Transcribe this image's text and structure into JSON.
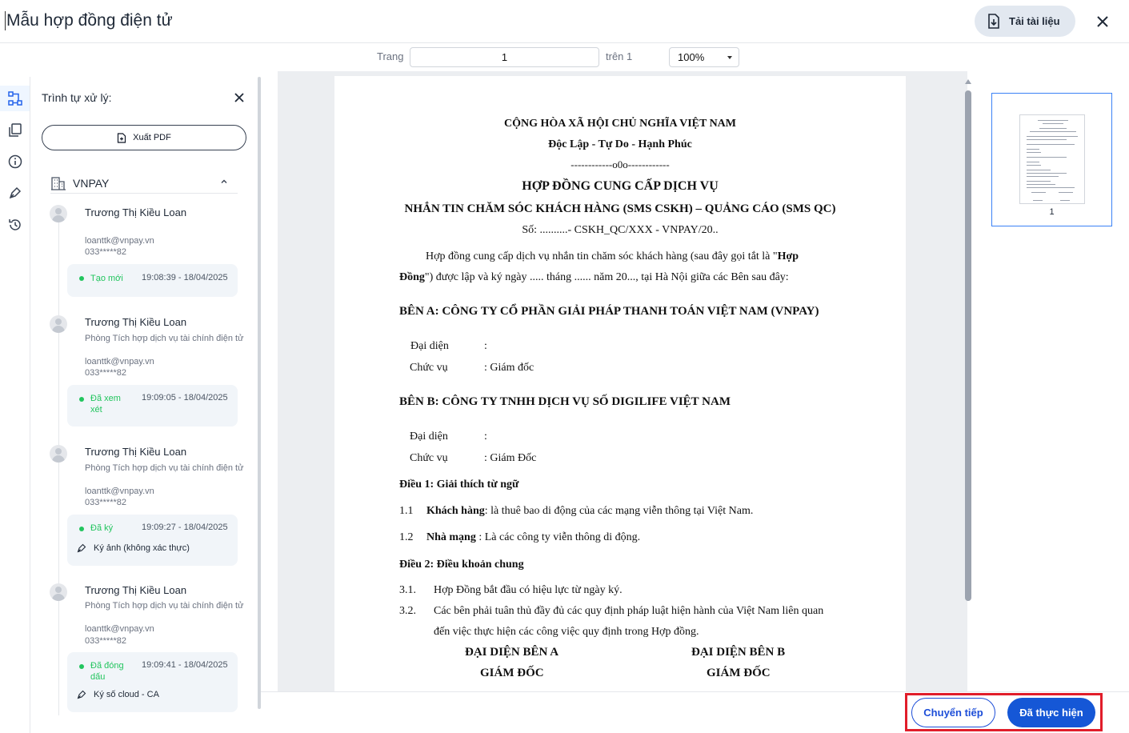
{
  "header": {
    "title": "Mẫu hợp đồng điện tử",
    "download_label": "Tải tài liệu"
  },
  "pager": {
    "page_label": "Trang",
    "page_value": "1",
    "of_label": "trên 1",
    "zoom_value": "100%"
  },
  "rail": {
    "icons": [
      "workflow-icon",
      "copy-icon",
      "info-icon",
      "pen-icon",
      "history-icon"
    ]
  },
  "panel": {
    "title": "Trình tự xử lý:",
    "export_label": "Xuất PDF",
    "org_name": "VNPAY",
    "steps": [
      {
        "name": "Trương Thị Kiều Loan",
        "email": "loanttk@vnpay.vn",
        "phone": "033*****82",
        "status": "Tạo mới",
        "time": "19:08:39 - 18/04/2025"
      },
      {
        "name": "Trương Thị Kiều Loan",
        "dept": "Phòng Tích hợp dịch vụ tài chính điện tử",
        "email": "loanttk@vnpay.vn",
        "phone": "033*****82",
        "status": "Đã xem xét",
        "time": "19:09:05 - 18/04/2025"
      },
      {
        "name": "Trương Thị Kiều Loan",
        "dept": "Phòng Tích hợp dịch vụ tài chính điện tử",
        "email": "loanttk@vnpay.vn",
        "phone": "033*****82",
        "status": "Đã ký",
        "time": "19:09:27 - 18/04/2025",
        "sign_type": "Ký ảnh (không xác thực)"
      },
      {
        "name": "Trương Thị Kiều Loan",
        "dept": "Phòng Tích hợp dịch vụ tài chính điện tử",
        "email": "loanttk@vnpay.vn",
        "phone": "033*****82",
        "status": "Đã đóng dấu",
        "time": "19:09:41 - 18/04/2025",
        "sign_type": "Ký số cloud - CA"
      }
    ]
  },
  "document": {
    "nation": "CỘNG HÒA XÃ HỘI CHỦ NGHĨA VIỆT NAM",
    "motto": "Độc Lập - Tự Do - Hạnh Phúc",
    "separator": "------------o0o------------",
    "title": "HỢP ĐỒNG CUNG CẤP DỊCH VỤ",
    "subtitle": "NHẮN TIN CHĂM SÓC KHÁCH HÀNG (SMS CSKH) – QUẢNG CÁO (SMS QC)",
    "number": "Số:  ..........- CSKH_QC/XXX - VNPAY/20..",
    "intro_1a": "Hợp đồng cung cấp dịch vụ nhắn tin chăm sóc khách hàng (sau đây gọi tắt là \"",
    "intro_1b": "Hợp",
    "intro_2a": "Đồng",
    "intro_2b": "\") được lập và ký ngày ..... tháng ...... năm 20..., tại Hà Nội giữa các Bên sau đây:",
    "party_a": "BÊN A: CÔNG TY CỔ PHẦN GIẢI PHÁP THANH TOÁN VIỆT NAM (VNPAY)",
    "party_a_rep_label": "Đại diện",
    "party_a_rep_value": ":",
    "party_a_pos_label": "Chức vụ",
    "party_a_pos_value": ": Giám đốc",
    "party_b": "BÊN B: CÔNG TY TNHH DỊCH VỤ SỐ DIGILIFE VIỆT NAM",
    "party_b_rep_label": "Đại diện",
    "party_b_rep_value": ":",
    "party_b_pos_label": "Chức vụ",
    "party_b_pos_value": ": Giám Đốc",
    "art1": "Điều 1: Giải thích từ ngữ",
    "art1_1_num": "1.1",
    "art1_1_term": "Khách hàng",
    "art1_1_text": ": là thuê bao di động của các mạng viễn thông tại Việt Nam.",
    "art1_2_num": "1.2",
    "art1_2_term": "Nhà mạng",
    "art1_2_text": " : Là các công ty viễn thông di động.",
    "art2": "Điều 2: Điều khoản chung",
    "art2_1_num": "3.1.",
    "art2_1_text": "Hợp Đồng bắt đầu có hiệu lực từ ngày ký.",
    "art2_2_num": "3.2.",
    "art2_2_text": "Các bên phải tuân thủ đầy đủ các quy định pháp luật hiện hành của Việt Nam liên quan",
    "art2_2_text2": "đến việc thực hiện các công việc quy định trong Hợp đồng.",
    "sig_a": "ĐẠI DIỆN BÊN A",
    "sig_b": "ĐẠI DIỆN BÊN B",
    "sig_a_title": "GIÁM ĐỐC",
    "sig_b_title": "GIÁM ĐỐC"
  },
  "thumbnail": {
    "page_number": "1"
  },
  "footer": {
    "forward_label": "Chuyển tiếp",
    "done_label": "Đã thực hiện"
  },
  "colors": {
    "primary": "#1557d6",
    "status_green": "#22c55e",
    "highlight_red": "#e11d2a"
  }
}
